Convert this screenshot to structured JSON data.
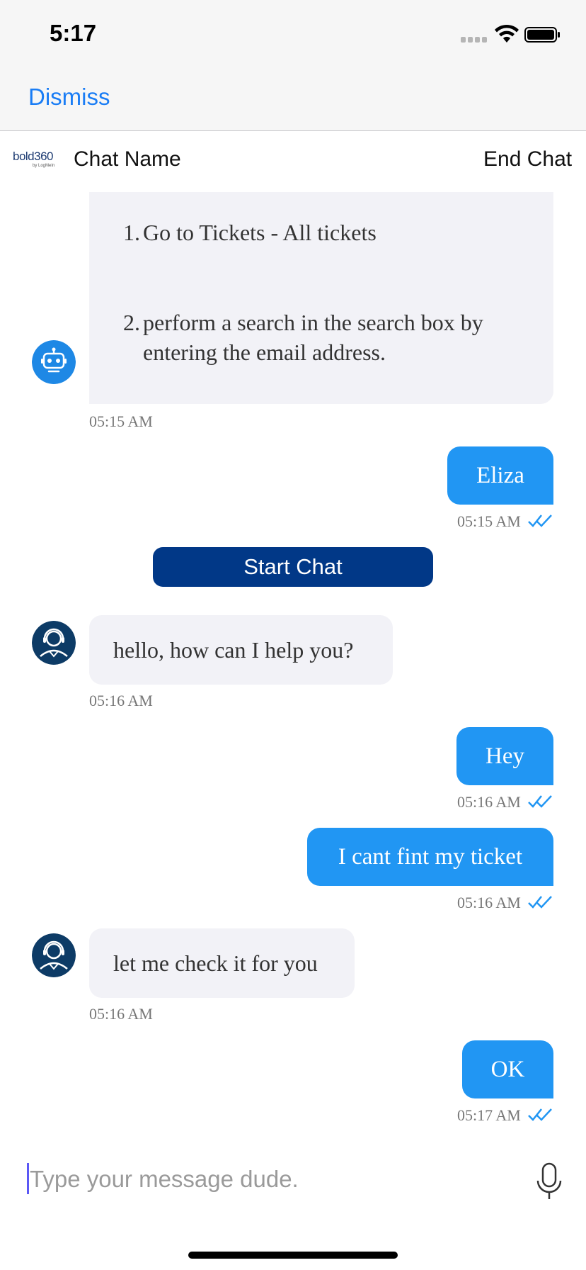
{
  "status_bar": {
    "time": "5:17",
    "icons": [
      "signal-icon",
      "wifi-icon",
      "battery-icon"
    ]
  },
  "nav": {
    "dismiss_label": "Dismiss"
  },
  "header": {
    "brand_logo_text": "bold360",
    "brand_logo_sub": "by LogMeIn",
    "chat_name": "Chat Name",
    "end_chat_label": "End Chat"
  },
  "messages": {
    "bot_list": {
      "items": [
        {
          "num": "1.",
          "text": "Go to Tickets - All tickets"
        },
        {
          "num": "2.",
          "text": "perform a search in the search box by entering the email address."
        }
      ],
      "time": "05:15 AM",
      "avatar_icon": "robot-icon"
    },
    "user_eliza": {
      "text": "Eliza",
      "time": "05:15 AM"
    },
    "start_chat_label": "Start Chat",
    "agent_hello": {
      "text": "hello, how can I help you?",
      "time": "05:16 AM",
      "avatar_icon": "agent-headset-icon"
    },
    "user_hey": {
      "text": "Hey",
      "time": "05:16 AM"
    },
    "user_ticket": {
      "text": "I cant fint my ticket",
      "time": "05:16 AM"
    },
    "agent_check": {
      "text": "let me check it for you",
      "time": "05:16 AM",
      "avatar_icon": "agent-headset-icon"
    },
    "user_ok": {
      "text": "OK",
      "time": "05:17 AM"
    }
  },
  "input": {
    "placeholder": "Type your message dude.",
    "value": "",
    "mic_icon": "microphone-icon"
  },
  "colors": {
    "accent_blue": "#1a7df5",
    "outgoing_bubble": "#2196f3",
    "incoming_bubble": "#f2f2f7",
    "start_chat_button": "#013887",
    "read_ticks": "#2196f3"
  }
}
